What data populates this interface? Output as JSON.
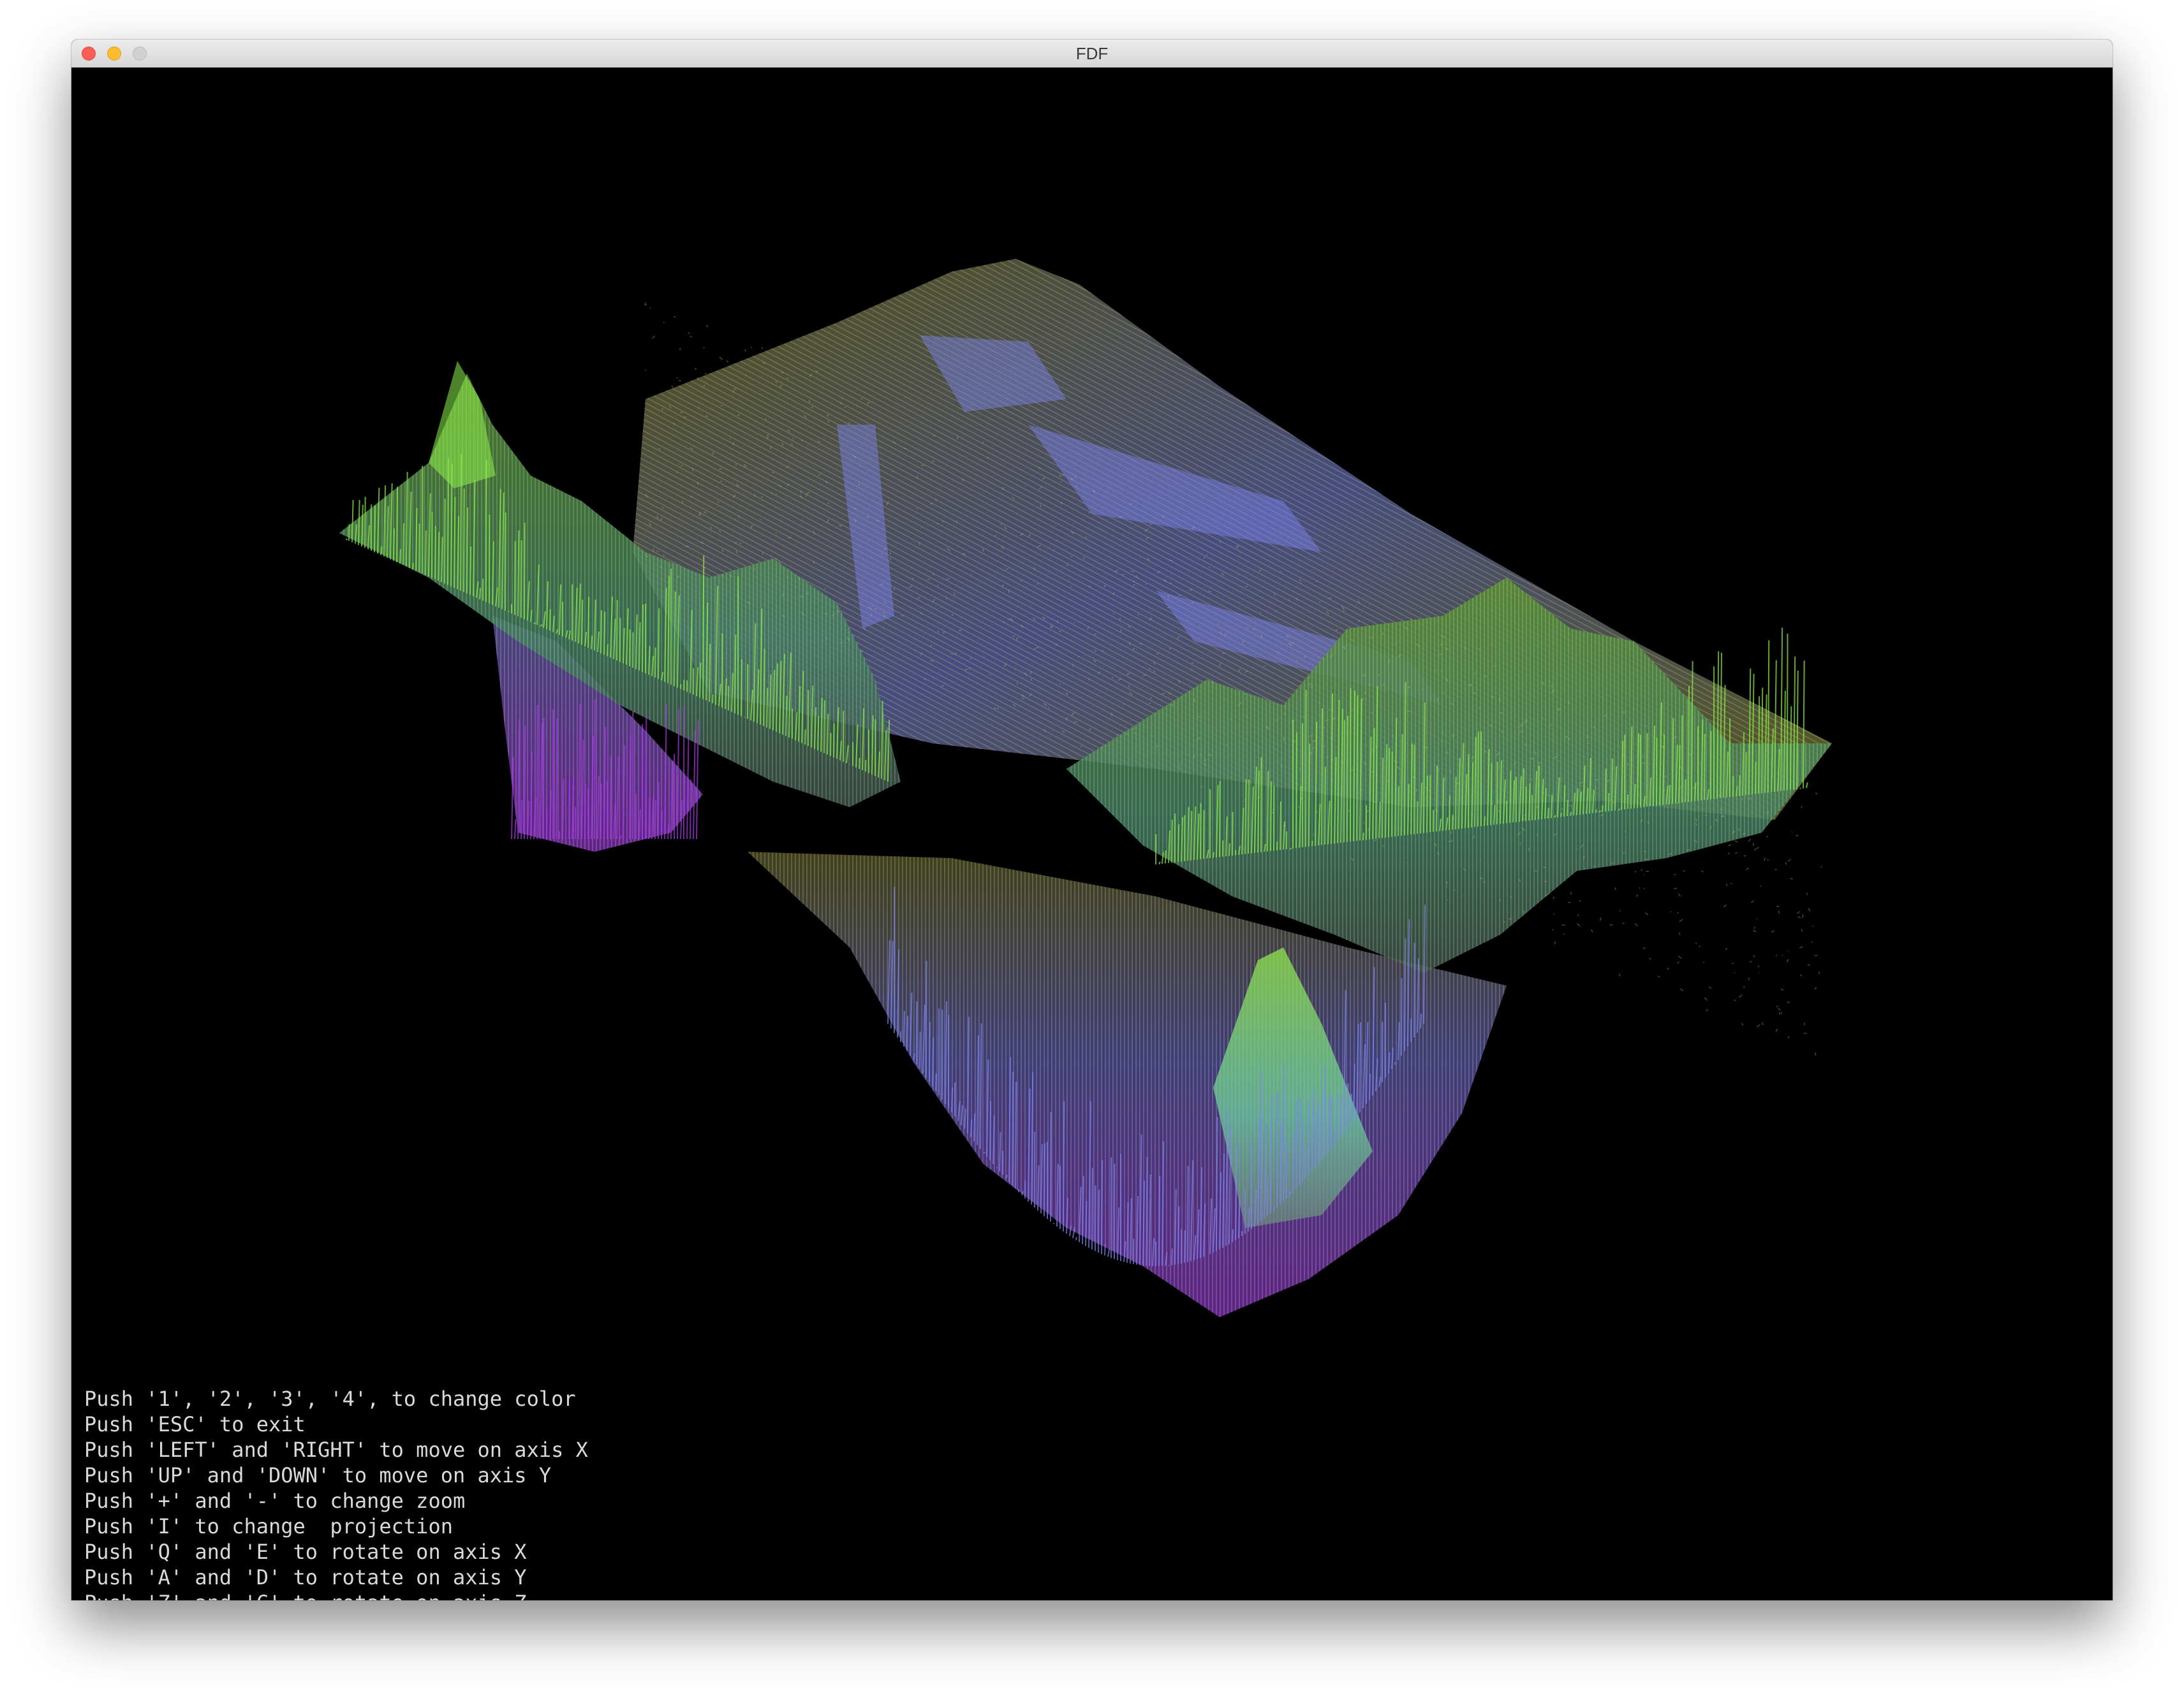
{
  "window": {
    "title": "FDF"
  },
  "colors": {
    "background": "#000000",
    "low": "#a83ae8",
    "mid": "#7d86f0",
    "plateau": "#8c8c2a",
    "high": "#8ef04a"
  },
  "instructions": [
    "Push '1', '2', '3', '4', to change color",
    "Push 'ESC' to exit",
    "Push 'LEFT' and 'RIGHT' to move on axis X",
    "Push 'UP' and 'DOWN' to move on axis Y",
    "Push '+' and '-' to change zoom",
    "Push 'I' to change  projection",
    "Push 'Q' and 'E' to rotate on axis X",
    "Push 'A' and 'D' to rotate on axis Y",
    "Push 'Z' and 'C' to rotate on axis Z"
  ]
}
